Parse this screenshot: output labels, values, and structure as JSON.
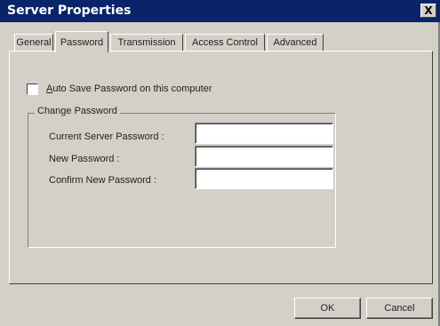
{
  "window": {
    "title": "Server Properties",
    "close_glyph": "X"
  },
  "tabs": [
    {
      "label": "General",
      "active": false
    },
    {
      "label": "Password",
      "active": true
    },
    {
      "label": "Transmission",
      "active": false
    },
    {
      "label": "Access Control",
      "active": false
    },
    {
      "label": "Advanced",
      "active": false
    }
  ],
  "auto_save": {
    "label_prefix": "A",
    "label_rest": "uto Save Password on this computer",
    "checked": false
  },
  "change_password": {
    "group_title": "Change Password",
    "fields": [
      {
        "label": "Current Server Password :",
        "value": ""
      },
      {
        "label": "New Password :",
        "value": ""
      },
      {
        "label": "Confirm New Password :",
        "value": ""
      }
    ]
  },
  "buttons": {
    "ok": "OK",
    "cancel": "Cancel"
  }
}
